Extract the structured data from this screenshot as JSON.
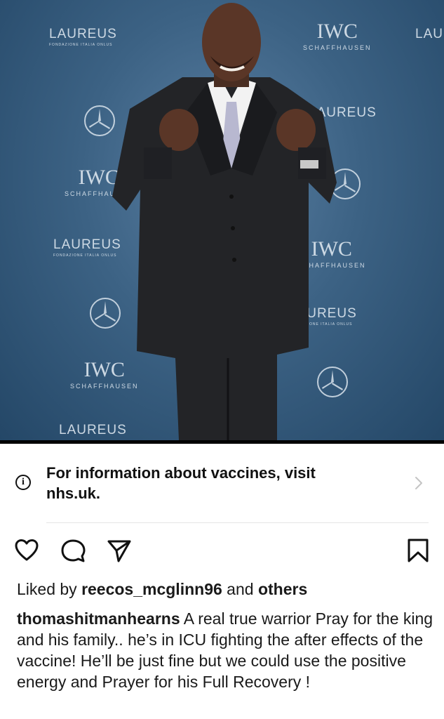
{
  "backdrop": {
    "laureus_brand": "LAUREUS",
    "laureus_subtitle": "FONDAZIONE ITALIA ONLUS",
    "iwc_brand": "IWC",
    "iwc_subtitle": "SCHAFFHAUSEN"
  },
  "notice": {
    "text": "For information about vaccines, visit nhs.uk."
  },
  "actions": {
    "like_icon": "heart-icon",
    "comment_icon": "comment-icon",
    "share_icon": "send-icon",
    "save_icon": "bookmark-icon"
  },
  "likes": {
    "prefix": "Liked by",
    "user": "reecos_mcglinn96",
    "conjunction": "and",
    "others": "others"
  },
  "caption": {
    "username": "thomashitmanhearns",
    "text": "A real true warrior Pray for the king and his family.. he’s in ICU fighting the after effects of the vaccine! He’ll be just fine but we could use the positive energy and Prayer for his Full Recovery !"
  },
  "colors": {
    "backdrop": "#3c6284",
    "text": "#111111",
    "divider": "#e4e4e4"
  }
}
